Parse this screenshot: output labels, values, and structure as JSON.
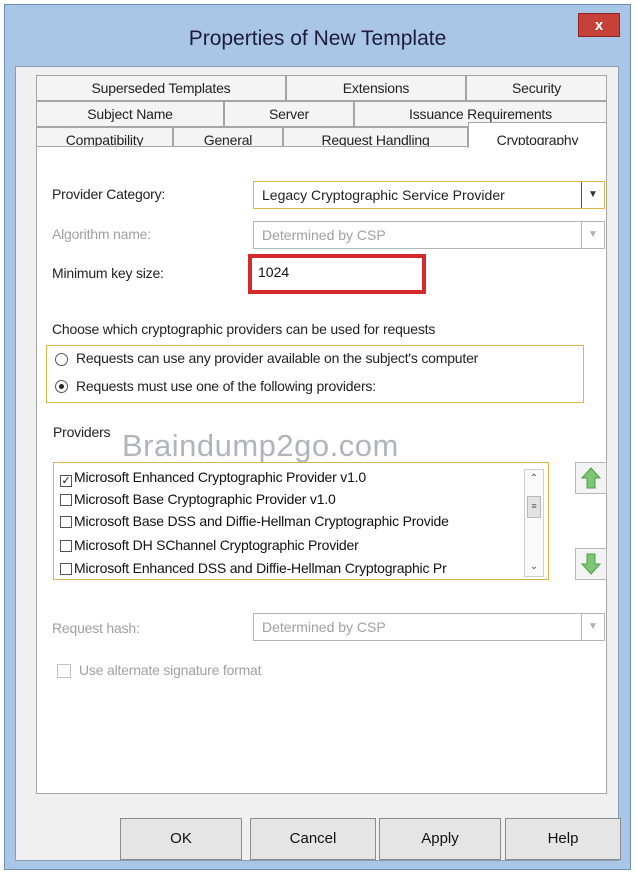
{
  "window": {
    "title": "Properties of New Template",
    "close_label": "x"
  },
  "tabs": {
    "row1": [
      "Superseded Templates",
      "Extensions",
      "Security"
    ],
    "row2": [
      "Subject Name",
      "Server",
      "Issuance Requirements"
    ],
    "row3": [
      "Compatibility",
      "General",
      "Request Handling",
      "Cryptography"
    ],
    "active": "Cryptography"
  },
  "crypto": {
    "provider_category_label": "Provider Category:",
    "provider_category_value": "Legacy Cryptographic Service Provider",
    "algorithm_label": "Algorithm name:",
    "algorithm_value": "Determined by CSP",
    "min_key_label": "Minimum key size:",
    "min_key_value": "1024",
    "choose_text": "Choose which cryptographic providers can be used for requests",
    "radio_any": "Requests can use any provider available on the subject's computer",
    "radio_must": "Requests must use one of the following providers:",
    "selected_radio": "must",
    "providers_label": "Providers",
    "providers": [
      {
        "name": "Microsoft Enhanced Cryptographic Provider v1.0",
        "checked": true
      },
      {
        "name": "Microsoft Base Cryptographic Provider v1.0",
        "checked": false
      },
      {
        "name": "Microsoft Base DSS and Diffie-Hellman Cryptographic Provide",
        "checked": false
      },
      {
        "name": "Microsoft DH SChannel Cryptographic Provider",
        "checked": false
      },
      {
        "name": "Microsoft Enhanced DSS and Diffie-Hellman Cryptographic Pr",
        "checked": false
      }
    ],
    "request_hash_label": "Request hash:",
    "request_hash_value": "Determined by CSP",
    "alt_signature_label": "Use alternate signature format",
    "alt_signature_checked": false
  },
  "watermark": "Braindump2go.com",
  "buttons": {
    "ok": "OK",
    "cancel": "Cancel",
    "apply": "Apply",
    "help": "Help"
  },
  "colors": {
    "highlight_border": "#d52a2a",
    "focus_border": "#e0b34a",
    "arrow_green": "#6fc36a"
  }
}
